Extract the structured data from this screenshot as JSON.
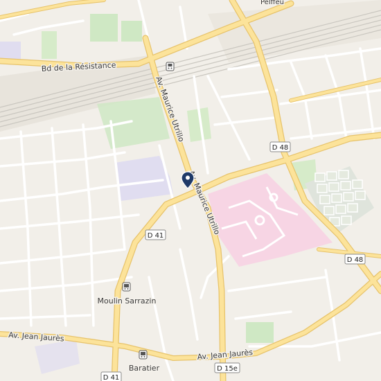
{
  "map": {
    "street_labels": {
      "bd_resistance": "Bd de la Résistance",
      "av_utrillo_north": "Av. Maurice Utrillo",
      "av_utrillo_south": "Av. Maurice Utrillo",
      "av_jaures_west": "Av. Jean Jaurès",
      "av_jaures_east": "Av. Jean Jaurès",
      "top_partial": "Pelfféu"
    },
    "road_shields": {
      "d48_top": "D 48",
      "d48_right": "D 48",
      "d41_mid": "D 41",
      "d41_bottom": "D 41",
      "d15e": "D 15e"
    },
    "stops": {
      "moulin_sarrazin": "Moulin Sarrazin",
      "baratier": "Baratier"
    },
    "icons": {
      "marker": "location-pin-icon",
      "bus": "bus-stop-icon",
      "train": "train-station-icon"
    },
    "colors": {
      "background": "#f2efe9",
      "major_road": "#fce39a",
      "major_road_casing": "#e7c36b",
      "minor_road": "#ffffff",
      "park": "#cfe8c4",
      "hospital": "#f7d5e4",
      "campus": "#e0ddf0",
      "marker": "#1f3a68"
    }
  }
}
